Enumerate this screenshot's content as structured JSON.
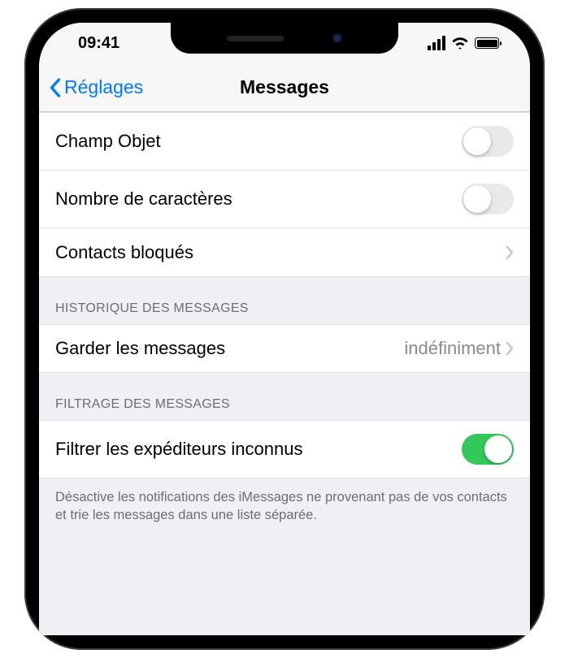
{
  "status": {
    "time": "09:41"
  },
  "nav": {
    "back_label": "Réglages",
    "title": "Messages"
  },
  "rows": {
    "subject_field": {
      "label": "Champ Objet",
      "on": false
    },
    "char_count": {
      "label": "Nombre de caractères",
      "on": false
    },
    "blocked": {
      "label": "Contacts bloqués"
    }
  },
  "history": {
    "header": "HISTORIQUE DES MESSAGES",
    "keep": {
      "label": "Garder les messages",
      "value": "indéfiniment"
    }
  },
  "filtering": {
    "header": "FILTRAGE DES MESSAGES",
    "filter_unknown": {
      "label": "Filtrer les expéditeurs inconnus",
      "on": true
    },
    "footer": "Désactive les notifications des iMessages ne provenant pas de vos contacts et trie les messages dans une liste séparée."
  },
  "colors": {
    "accent": "#007aff",
    "toggle_on": "#34c759"
  }
}
